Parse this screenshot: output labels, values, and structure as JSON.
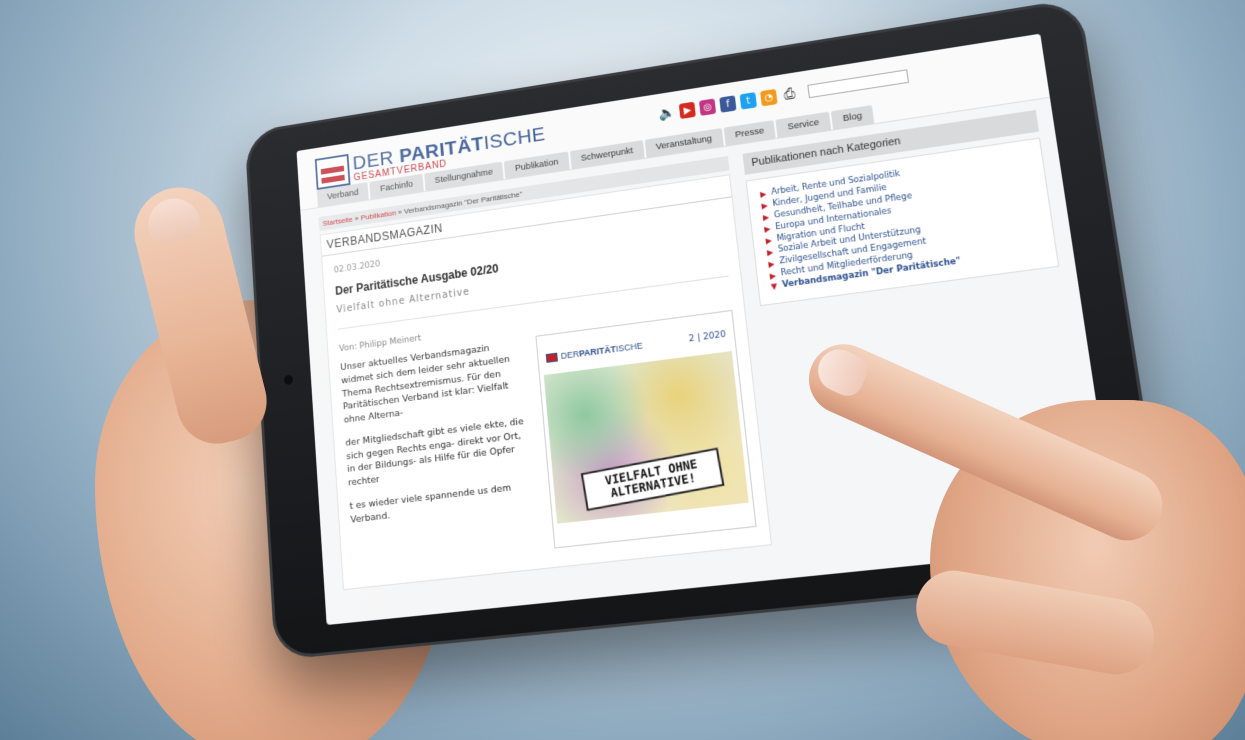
{
  "site": {
    "logo_main_a": "DER ",
    "logo_main_b": "PARITÄT",
    "logo_main_c": "ISCHE",
    "logo_sub": "GESAMTVERBAND"
  },
  "nav": [
    "Verband",
    "Fachinfo",
    "Stellungnahme",
    "Publikation",
    "Schwerpunkt",
    "Veranstaltung",
    "Presse",
    "Service",
    "Blog"
  ],
  "breadcrumb": {
    "home": "Startseite",
    "sep1": " » ",
    "section": "Publikation",
    "sep2": " » ",
    "current": "Verbandsmagazin \"Der Paritätische\""
  },
  "article": {
    "section": "VERBANDSMAGAZIN",
    "date": "02.03.2020",
    "title": "Der Paritätische Ausgabe 02/20",
    "subtitle": "Vielfalt ohne Alternative",
    "author": "Von: Philipp Meinert",
    "para1": "Unser aktuelles Verbandsmagazin widmet sich dem leider sehr aktuellen Thema Rechtsextremismus. Für den Paritätischen Verband ist klar: Vielfalt ohne Alterna-",
    "para2": "der Mitgliedschaft gibt es viele ekte, die sich gegen Rechts enga- direkt vor Ort, in der Bildungs- als Hilfe für die Opfer rechter",
    "para3": "t es wieder viele spannende us dem Verband."
  },
  "cover": {
    "logo_a": "DER ",
    "logo_b": "PARITÄT",
    "logo_c": "ISCHE",
    "issue": "2 | 2020",
    "banner_line1": "VIELFALT OHNE",
    "banner_line2": "ALTERNATIVE!"
  },
  "sidebar": {
    "heading": "Publikationen nach Kategorien",
    "categories": [
      "Arbeit, Rente und Sozialpolitik",
      "Kinder, Jugend und Familie",
      "Gesundheit, Teilhabe und Pflege",
      "Europa und Internationales",
      "Migration und Flucht",
      "Soziale Arbeit und Unterstützung",
      "Zivilgesellschaft und Engagement",
      "Recht und Mitgliederförderung",
      "Verbandsmagazin \"Der Paritätische\""
    ]
  },
  "icons": [
    "speaker-icon",
    "youtube-icon",
    "instagram-icon",
    "facebook-icon",
    "twitter-icon",
    "rss-icon",
    "print-icon"
  ],
  "colors": {
    "brand_blue": "#2d4f8c",
    "brand_red": "#c0202a"
  }
}
